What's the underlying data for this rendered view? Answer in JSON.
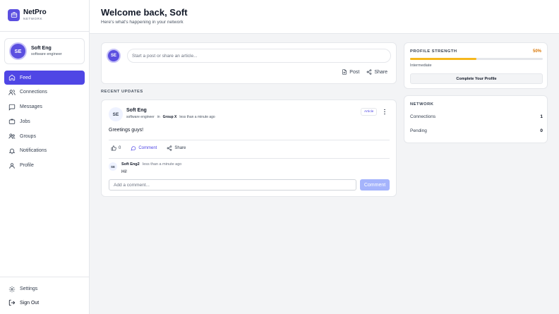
{
  "brand": {
    "name": "NetPro",
    "sub": "NETWORK"
  },
  "user": {
    "initials": "SE",
    "name": "Soft Eng",
    "role": "software engineer"
  },
  "nav": [
    {
      "label": "Feed",
      "icon": "home-icon",
      "active": true
    },
    {
      "label": "Connections",
      "icon": "users-icon"
    },
    {
      "label": "Messages",
      "icon": "message-icon"
    },
    {
      "label": "Jobs",
      "icon": "briefcase-icon"
    },
    {
      "label": "Groups",
      "icon": "groups-icon"
    },
    {
      "label": "Notifications",
      "icon": "bell-icon"
    },
    {
      "label": "Profile",
      "icon": "user-icon"
    }
  ],
  "bottom_nav": [
    {
      "label": "Settings",
      "icon": "gear-icon"
    },
    {
      "label": "Sign Out",
      "icon": "sign-out-icon"
    }
  ],
  "header": {
    "title": "Welcome back, Soft",
    "subtitle": "Here's what's happening in your network"
  },
  "composer": {
    "initials": "SE",
    "placeholder": "Start a post or share an article...",
    "post_label": "Post",
    "share_label": "Share"
  },
  "feed": {
    "section_label": "RECENT UPDATES",
    "post": {
      "initials": "SE",
      "author": "Soft Eng",
      "role": "software engineer",
      "in": "in",
      "group": "Group X",
      "time": "less than a minute ago",
      "badge": "Article",
      "body": "Greetings guys!",
      "likes": "0",
      "comment_label": "Comment",
      "share_label": "Share",
      "comment": {
        "initials": "SE",
        "author": "Soft Eng2",
        "time": "less than a minute ago",
        "text": "Hi!"
      },
      "comment_placeholder": "Add a comment...",
      "comment_button": "Comment"
    }
  },
  "strength": {
    "title": "PROFILE STRENGTH",
    "percent_label": "50%",
    "percent": 0.5,
    "level": "Intermediate",
    "button": "Complete Your Profile"
  },
  "network": {
    "title": "NETWORK",
    "connections_label": "Connections",
    "connections": "1",
    "pending_label": "Pending",
    "pending": "0"
  },
  "colors": {
    "accent": "#4f46e5",
    "progress": "#f5b71d",
    "percent_text": "#d97706"
  }
}
